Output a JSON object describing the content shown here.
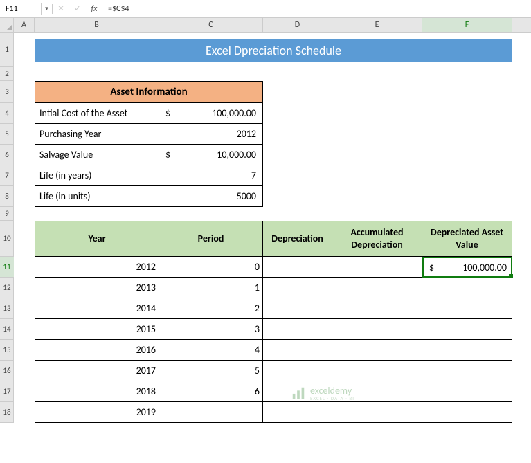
{
  "formula_bar": {
    "name_box": "F11",
    "formula": "=$C$4"
  },
  "columns": [
    "A",
    "B",
    "C",
    "D",
    "E",
    "F"
  ],
  "title": "Excel Dpreciation Schedule",
  "asset_info": {
    "header": "Asset Information",
    "rows": [
      {
        "label": "Intial Cost of the Asset",
        "dollar": "$",
        "value": "100,000.00"
      },
      {
        "label": "Purchasing Year",
        "dollar": "",
        "value": "2012"
      },
      {
        "label": "Salvage Value",
        "dollar": "$",
        "value": "10,000.00"
      },
      {
        "label": "Life (in years)",
        "dollar": "",
        "value": "7"
      },
      {
        "label": "Life (in units)",
        "dollar": "",
        "value": "5000"
      }
    ]
  },
  "schedule": {
    "headers": {
      "year": "Year",
      "period": "Period",
      "depreciation": "Depreciation",
      "accumulated": "Accumulated Depreciation",
      "depreciated": "Depreciated Asset Value"
    },
    "rows": [
      {
        "year": "2012",
        "period": "0",
        "f_dollar": "$",
        "f_value": "100,000.00"
      },
      {
        "year": "2013",
        "period": "1"
      },
      {
        "year": "2014",
        "period": "2"
      },
      {
        "year": "2015",
        "period": "3"
      },
      {
        "year": "2016",
        "period": "4"
      },
      {
        "year": "2017",
        "period": "5"
      },
      {
        "year": "2018",
        "period": "6"
      },
      {
        "year": "2019",
        "period": ""
      }
    ]
  },
  "watermark": {
    "brand": "exceldemy",
    "sub": "EXCEL · DATA · BI"
  }
}
